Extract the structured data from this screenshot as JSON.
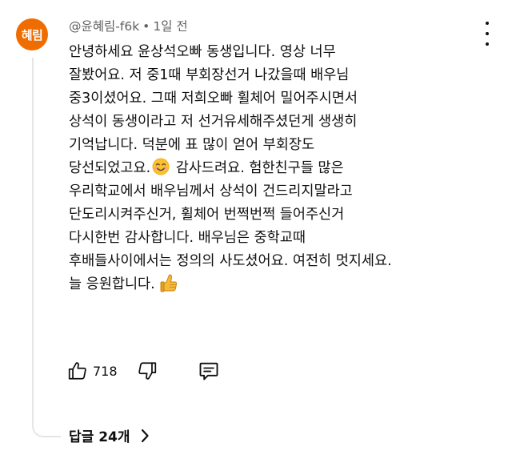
{
  "comment": {
    "avatar_text": "혜림",
    "author": "@윤혜림-f6k",
    "separator": "•",
    "time_ago": "1일 전",
    "lines": [
      "안녕하세요 윤상석오빠 동생입니다. 영상 너무",
      "잘봤어요. 저 중1때 부회장선거 나갔을때 배우님",
      "중3이셨어요. 그때 저희오빠 휠체어 밀어주시면서",
      "상석이 동생이라고 저 선거유세해주셨던게 생생히",
      "기억납니다. 덕분에 표 많이 얻어 부회장도",
      "당선되었고요.",
      " 감사드려요. 험한친구들 많은",
      "우리학교에서 배우님께서 상석이 건드리지말라고",
      "단도리시켜주신거, 휠체어 번쩍번쩍 들어주신거",
      "다시한번 감사합니다. 배우님은 중학교때",
      "후배들사이에서는 정의의 사도셨어요. 여전히 멋지세요.",
      "늘 응원합니다."
    ],
    "emojis": {
      "smile": "smiling-face-emoji",
      "thumb": "thumbs-up-emoji"
    },
    "like_count": "718",
    "replies_label": "답글 24개"
  },
  "colors": {
    "avatar_bg": "#ef6c00",
    "meta_text": "#606060",
    "thread_line": "#e5e5e5",
    "text": "#0f0f0f"
  }
}
